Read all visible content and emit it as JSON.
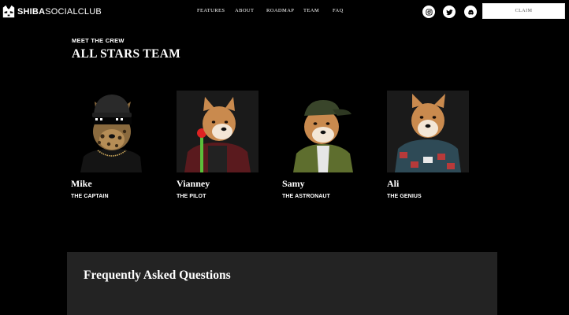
{
  "brand": {
    "name_bold": "SHIBA",
    "name_light": "SOCIALCLUB"
  },
  "nav": {
    "links": [
      "FEATURES",
      "ABOUT",
      "ROADMAP",
      "TEAM",
      "FAQ"
    ],
    "social_icons": [
      "instagram-icon",
      "twitter-icon",
      "discord-icon"
    ],
    "cta_label": "CLAIM"
  },
  "team": {
    "eyebrow": "MEET THE CREW",
    "title": "ALL STARS TEAM",
    "members": [
      {
        "name": "Mike",
        "role": "THE CAPTAIN"
      },
      {
        "name": "Vianney",
        "role": "THE PILOT"
      },
      {
        "name": "Samy",
        "role": "THE ASTRONAUT"
      },
      {
        "name": "Ali",
        "role": "THE GENIUS"
      }
    ]
  },
  "faq": {
    "title": "Frequently Asked Questions"
  },
  "colors": {
    "page_bg": "#000000",
    "panel_bg": "#232323",
    "text": "#ffffff",
    "button_bg": "#ffffff",
    "button_text": "#555555"
  }
}
